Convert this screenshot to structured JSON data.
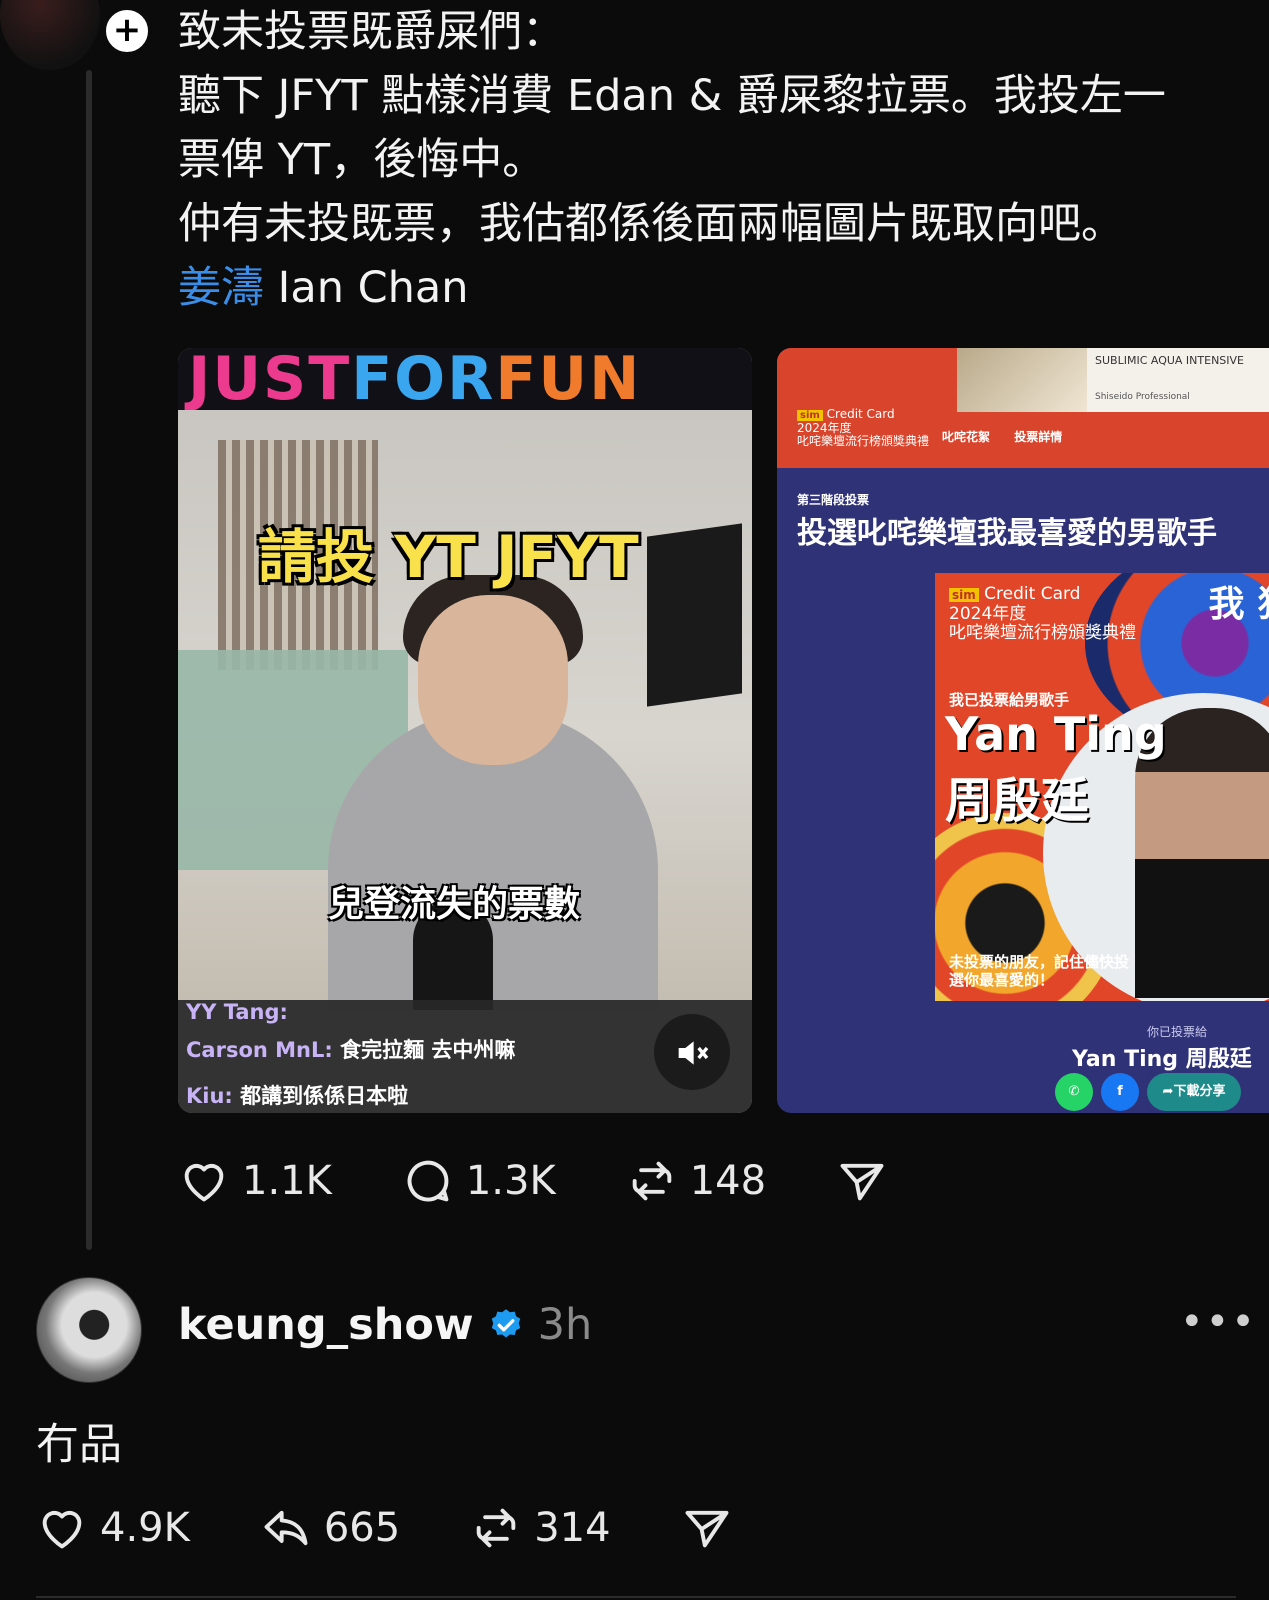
{
  "post": {
    "lines": [
      "致未投票既爵屎們：",
      "聽下 JFYT 點樣消費 Edan & 爵屎黎拉票。我投左一",
      "票俾 YT，後悔中。",
      "仲有未投既票，我估都係後面兩幅圖片既取向吧。"
    ],
    "mention_zh": "姜濤",
    "mention_en": " Ian Chan",
    "follow_icon": "plus-icon"
  },
  "video": {
    "brand_parts": [
      "JUST",
      "FOR",
      "FUN"
    ],
    "caption_top": "請投 YT JFYT",
    "caption_sub": "兒登流失的票數",
    "chat": [
      {
        "name": "YY Tang:",
        "msg": ""
      },
      {
        "name": "Carson MnL:",
        "msg": "食完拉麵 去中州嘛"
      },
      {
        "name": "Kiu:",
        "msg": "都講到係係日本啦"
      }
    ],
    "mute_icon": "muted-speaker-icon"
  },
  "poster": {
    "ad_title": "SUBLIMIC AQUA INTENSIVE",
    "ad_brand": "Shiseido Professional",
    "logo_sim": "sim",
    "logo_cc": "Credit Card",
    "logo_year": "2024年度",
    "logo_event": "叱咤樂壇流行榜頒獎典禮",
    "nav": [
      "叱咤花絮",
      "投票詳情"
    ],
    "stage": "第三階段投票",
    "title": "投選叱咤樂壇我最喜愛的男歌手",
    "card_year": "2024年度",
    "card_event": "叱咤樂壇流行榜頒獎典禮",
    "card_voted": "我已投票給男歌手",
    "card_name_en": "Yan Ting",
    "card_name_zh": "周殷廷",
    "card_side": "我 狂",
    "card_remind": "未投票的朋友，記住儘快投選你最喜愛的！",
    "foot_label": "你已投票給",
    "foot_name": "Yan Ting 周殷廷",
    "share_download": "➦下載分享"
  },
  "post_actions": {
    "likes": "1.1K",
    "comments": "1.3K",
    "reposts": "148"
  },
  "reply": {
    "username": "keung_show",
    "time": "3h",
    "text": "冇品",
    "more": "•••",
    "likes": "4.9K",
    "replies": "665",
    "reposts": "314"
  },
  "colors": {
    "background": "#0b0b0b",
    "mention": "#3b8de8",
    "verified": "#1d9bf0"
  }
}
